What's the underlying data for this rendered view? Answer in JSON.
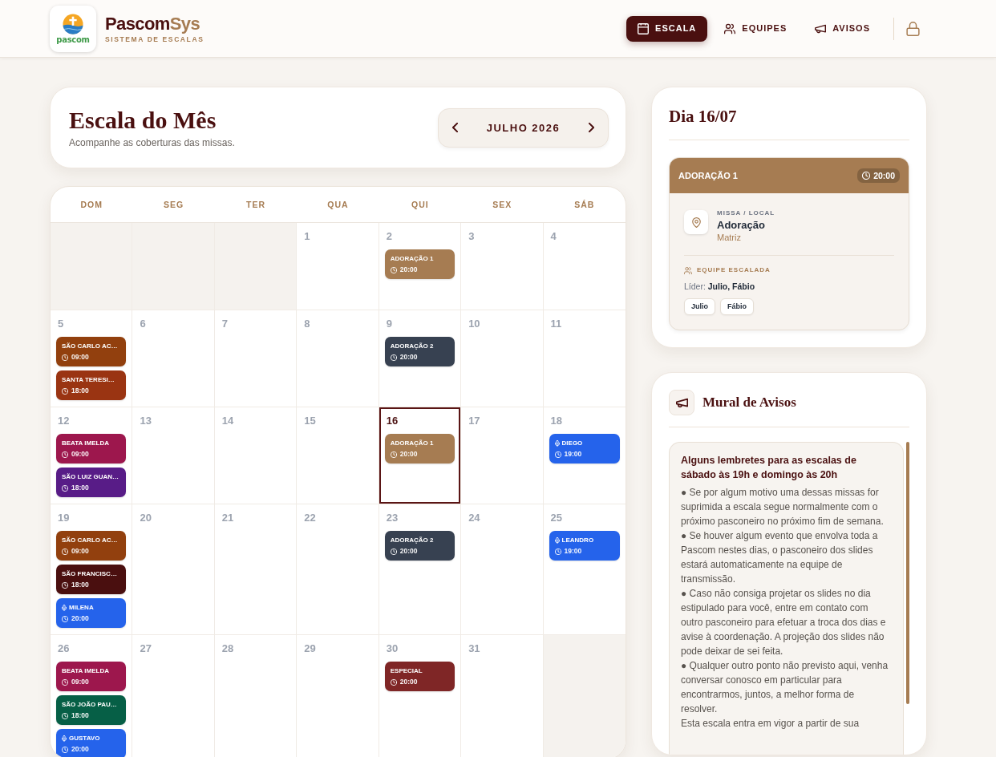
{
  "header": {
    "logo_text": "pascom",
    "brand": "Pascom**Sys**",
    "tagline": "SISTEMA DE ESCALAS",
    "nav": [
      {
        "label": "ESCALA",
        "selected": true
      },
      {
        "label": "EQUIPES",
        "selected": false
      },
      {
        "label": "AVISOS",
        "selected": false
      }
    ]
  },
  "month_card": {
    "title": "Escala do Mês",
    "subtitle": "Acompanhe as coberturas das missas.",
    "month": "JULHO 2026"
  },
  "calendar": {
    "weekdays": [
      "DOM",
      "SEG",
      "TER",
      "QUA",
      "QUI",
      "SEX",
      "SÁB"
    ],
    "weeks": [
      [
        {
          "outside": true,
          "selected": false
        },
        {
          "outside": true,
          "selected": false
        },
        {
          "outside": true,
          "selected": false
        },
        {
          "day": "1",
          "outside": false,
          "selected": false
        },
        {
          "day": "2",
          "outside": false,
          "selected": false,
          "events": [
            {
              "kind": "mass",
              "title": "ADORAÇÃO 1",
              "time": "20:00",
              "color": "#a67c52"
            }
          ]
        },
        {
          "day": "3",
          "outside": false,
          "selected": false
        },
        {
          "day": "4",
          "outside": false,
          "selected": false
        }
      ],
      [
        {
          "day": "5",
          "outside": false,
          "selected": false,
          "events": [
            {
              "kind": "mass",
              "title": "SÃO CARLO AC…",
              "time": "09:00",
              "color": "#92400e"
            },
            {
              "kind": "mass",
              "title": "SANTA TERESI…",
              "time": "18:00",
              "color": "#9a3412"
            }
          ]
        },
        {
          "day": "6",
          "outside": false,
          "selected": false
        },
        {
          "day": "7",
          "outside": false,
          "selected": false
        },
        {
          "day": "8",
          "outside": false,
          "selected": false
        },
        {
          "day": "9",
          "outside": false,
          "selected": false,
          "events": [
            {
              "kind": "mass",
              "title": "ADORAÇÃO 2",
              "time": "20:00",
              "color": "#374151"
            }
          ]
        },
        {
          "day": "10",
          "outside": false,
          "selected": false
        },
        {
          "day": "11",
          "outside": false,
          "selected": false
        }
      ],
      [
        {
          "day": "12",
          "outside": false,
          "selected": false,
          "events": [
            {
              "kind": "mass",
              "title": "BEATA IMELDA",
              "time": "09:00",
              "color": "#9d174d"
            },
            {
              "kind": "mass",
              "title": "SÃO LUIZ GUAN…",
              "time": "18:00",
              "color": "#581c87"
            }
          ]
        },
        {
          "day": "13",
          "outside": false,
          "selected": false
        },
        {
          "day": "14",
          "outside": false,
          "selected": false
        },
        {
          "day": "15",
          "outside": false,
          "selected": false
        },
        {
          "day": "16",
          "outside": false,
          "selected": true,
          "events": [
            {
              "kind": "mass",
              "title": "ADORAÇÃO 1",
              "time": "20:00",
              "color": "#a67c52"
            }
          ]
        },
        {
          "day": "17",
          "outside": false,
          "selected": false
        },
        {
          "day": "18",
          "outside": false,
          "selected": false,
          "events": [
            {
              "kind": "member",
              "title": "DIEGO",
              "time": "19:00",
              "color": "#2563eb"
            }
          ]
        }
      ],
      [
        {
          "day": "19",
          "outside": false,
          "selected": false,
          "events": [
            {
              "kind": "mass",
              "title": "SÃO CARLO AC…",
              "time": "09:00",
              "color": "#92400e"
            },
            {
              "kind": "mass",
              "title": "SÃO FRANCISC…",
              "time": "18:00",
              "color": "#4a0f0f"
            },
            {
              "kind": "member",
              "title": "MILENA",
              "time": "20:00",
              "color": "#2563eb"
            }
          ]
        },
        {
          "day": "20",
          "outside": false,
          "selected": false
        },
        {
          "day": "21",
          "outside": false,
          "selected": false
        },
        {
          "day": "22",
          "outside": false,
          "selected": false
        },
        {
          "day": "23",
          "outside": false,
          "selected": false,
          "events": [
            {
              "kind": "mass",
              "title": "ADORAÇÃO 2",
              "time": "20:00",
              "color": "#374151"
            }
          ]
        },
        {
          "day": "24",
          "outside": false,
          "selected": false
        },
        {
          "day": "25",
          "outside": false,
          "selected": false,
          "events": [
            {
              "kind": "member",
              "title": "LEANDRO",
              "time": "19:00",
              "color": "#2563eb"
            }
          ]
        }
      ],
      [
        {
          "day": "26",
          "outside": false,
          "selected": false,
          "events": [
            {
              "kind": "mass",
              "title": "BEATA IMELDA",
              "time": "09:00",
              "color": "#9d174d"
            },
            {
              "kind": "mass",
              "title": "SÃO JOÃO PAU…",
              "time": "18:00",
              "color": "#065f46"
            },
            {
              "kind": "member",
              "title": "GUSTAVO",
              "time": "20:00",
              "color": "#2563eb"
            }
          ]
        },
        {
          "day": "27",
          "outside": false,
          "selected": false
        },
        {
          "day": "28",
          "outside": false,
          "selected": false
        },
        {
          "day": "29",
          "outside": false,
          "selected": false
        },
        {
          "day": "30",
          "outside": false,
          "selected": false,
          "events": [
            {
              "kind": "mass",
              "title": "ESPECIAL",
              "time": "20:00",
              "color": "#7f2626"
            }
          ]
        },
        {
          "day": "31",
          "outside": false,
          "selected": false
        },
        {
          "outside": true,
          "selected": false
        }
      ]
    ]
  },
  "day_panel": {
    "title": "Dia 16/07",
    "event": {
      "title": "ADORAÇÃO 1",
      "time": "20:00",
      "color": "#a67c52",
      "location_label": "MISSA / LOCAL",
      "location": "Adoração",
      "place": "Matriz",
      "team_label": "EQUIPE ESCALADA",
      "leader": "Líder: **Julio, Fábio**",
      "members": [
        "Julio",
        "Fábio"
      ]
    }
  },
  "notice_board": {
    "title": "Mural de Avisos",
    "notice": {
      "title": "Alguns lembretes para as escalas de sábado às 19h e domingo às 20h",
      "paragraphs": [
        "● Se por algum motivo uma dessas missas for suprimida a escala segue normalmente com o próximo pasconeiro no próximo fim de semana.",
        "● Se houver algum evento que envolva toda a Pascom nestes dias, o pasconeiro dos slides estará automaticamente na equipe de transmissão.",
        "● Caso não consiga projetar os slides no dia estipulado para você, entre em contato com outro pasconeiro para efetuar a troca dos dias e avise à coordenação. A projeção dos slides não pode deixar de sei feita.",
        "● Qualquer outro ponto não previsto aqui, venha conversar conosco em particular para encontrarmos, juntos, a melhor forma de resolver.",
        "Esta escala entra em vigor a partir de sua"
      ]
    }
  }
}
